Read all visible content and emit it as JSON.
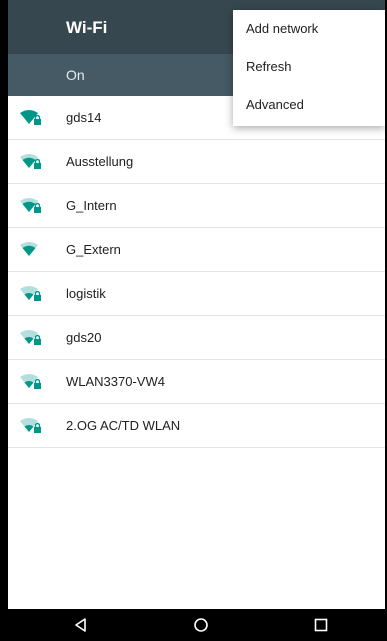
{
  "appbar": {
    "title": "Wi-Fi"
  },
  "status": {
    "label": "On"
  },
  "menu": {
    "items": [
      {
        "label": "Add network"
      },
      {
        "label": "Refresh"
      },
      {
        "label": "Advanced"
      }
    ]
  },
  "networks": [
    {
      "name": "gds14",
      "signal": "full",
      "locked": true
    },
    {
      "name": "Ausstellung",
      "signal": "medium",
      "locked": true
    },
    {
      "name": "G_Intern",
      "signal": "medium",
      "locked": true
    },
    {
      "name": "G_Extern",
      "signal": "medium",
      "locked": false
    },
    {
      "name": "logistik",
      "signal": "weak",
      "locked": true
    },
    {
      "name": "gds20",
      "signal": "weak",
      "locked": true
    },
    {
      "name": "WLAN3370-VW4",
      "signal": "weak",
      "locked": true
    },
    {
      "name": "2.OG AC/TD WLAN",
      "signal": "weak",
      "locked": true
    }
  ],
  "colors": {
    "appbar": "#37474f",
    "status_bar": "#455a64",
    "accent": "#009688",
    "wifi_dim": "#b2dfdb"
  },
  "navbar": {
    "icons": [
      "back-icon",
      "home-icon",
      "recents-icon"
    ]
  }
}
